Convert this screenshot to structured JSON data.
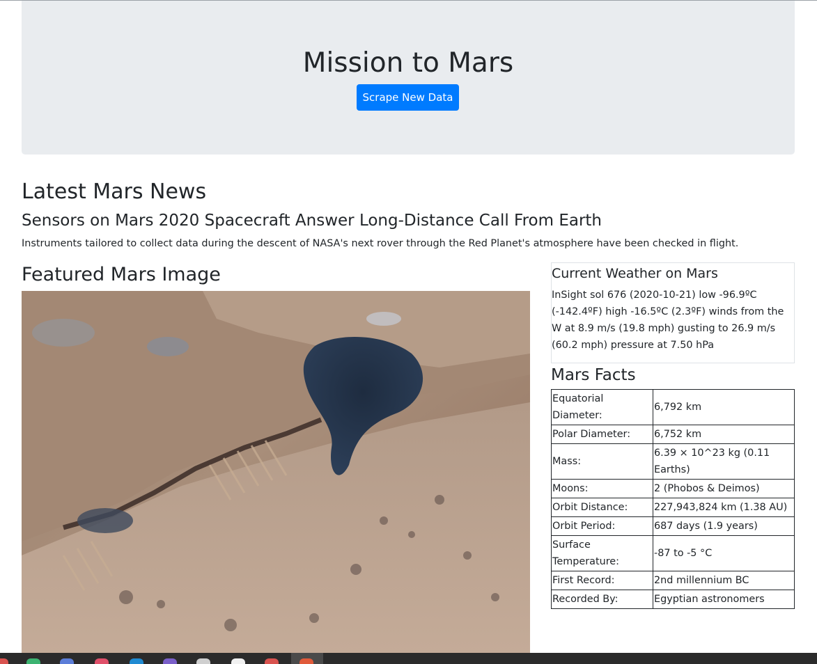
{
  "jumbotron": {
    "title": "Mission to Mars",
    "button_label": "Scrape New Data"
  },
  "news": {
    "section_heading": "Latest Mars News",
    "title": "Sensors on Mars 2020 Spacecraft Answer Long-Distance Call From Earth",
    "paragraph": "Instruments tailored to collect data during the descent of NASA's next rover through the Red Planet's atmosphere have been checked in flight."
  },
  "featured": {
    "heading": "Featured Mars Image"
  },
  "weather": {
    "heading": "Current Weather on Mars",
    "text": "InSight sol 676 (2020-10-21) low -96.9ºC (-142.4ºF) high -16.5ºC (2.3ºF) winds from the W at 8.9 m/s (19.8 mph) gusting to 26.9 m/s (60.2 mph) pressure at 7.50 hPa"
  },
  "facts": {
    "heading": "Mars Facts",
    "rows": [
      {
        "label": "Equatorial Diameter:",
        "value": "6,792 km"
      },
      {
        "label": "Polar Diameter:",
        "value": "6,752 km"
      },
      {
        "label": "Mass:",
        "value": "6.39 × 10^23 kg (0.11 Earths)"
      },
      {
        "label": "Moons:",
        "value": "2 (Phobos & Deimos)"
      },
      {
        "label": "Orbit Distance:",
        "value": "227,943,824 km (1.38 AU)"
      },
      {
        "label": "Orbit Period:",
        "value": "687 days (1.9 years)"
      },
      {
        "label": "Surface Temperature:",
        "value": "-87 to -5 °C"
      },
      {
        "label": "First Record:",
        "value": "2nd millennium BC"
      },
      {
        "label": "Recorded By:",
        "value": "Egyptian astronomers"
      }
    ]
  },
  "taskbar": {
    "icons": [
      "app-icon-1",
      "app-icon-2",
      "app-icon-3",
      "app-icon-4",
      "vscode-icon",
      "app-icon-6",
      "terminal-icon",
      "chrome-icon",
      "app-icon-9",
      "app-icon-10"
    ]
  },
  "colors": {
    "primary": "#007bff",
    "jumbotron_bg": "#e9ecef",
    "taskbar_bg": "#2b2b2b"
  }
}
